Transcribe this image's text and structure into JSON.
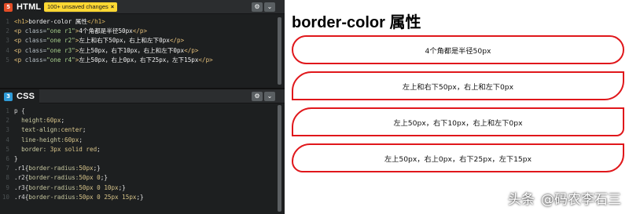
{
  "html_pane": {
    "title": "HTML",
    "icon": "html5-icon",
    "unsaved_badge": "100+ unsaved changes",
    "unsaved_close": "×",
    "settings_icon": "⚙",
    "collapse_icon": "⌄",
    "lines": [
      {
        "n": "1",
        "parts": [
          [
            "tagb",
            "<h1>"
          ],
          [
            "txt",
            "border-color 属性"
          ],
          [
            "tagb",
            "</h1>"
          ]
        ]
      },
      {
        "n": "2",
        "parts": [
          [
            "tag",
            "<p "
          ],
          [
            "attr",
            "class="
          ],
          [
            "str",
            "\"one r1\""
          ],
          [
            "tag",
            ">"
          ],
          [
            "txt",
            "4个角都是半径50px"
          ],
          [
            "tag",
            "</p>"
          ]
        ]
      },
      {
        "n": "3",
        "parts": [
          [
            "tag",
            "<p "
          ],
          [
            "attr",
            "class="
          ],
          [
            "str",
            "\"one r2\""
          ],
          [
            "tag",
            ">"
          ],
          [
            "txt",
            "左上和右下50px，右上和左下0px"
          ],
          [
            "tag",
            "</p>"
          ]
        ]
      },
      {
        "n": "4",
        "parts": [
          [
            "tag",
            "<p "
          ],
          [
            "attr",
            "class="
          ],
          [
            "str",
            "\"one r3\""
          ],
          [
            "tag",
            ">"
          ],
          [
            "txt",
            "左上50px，右下10px，右上和左下0px"
          ],
          [
            "tag",
            "</p>"
          ]
        ]
      },
      {
        "n": "5",
        "parts": [
          [
            "tag",
            "<p "
          ],
          [
            "attr",
            "class="
          ],
          [
            "str",
            "\"one r4\""
          ],
          [
            "tag",
            ">"
          ],
          [
            "txt",
            "左上50px，右上0px，右下25px，左下15px"
          ],
          [
            "tag",
            "</p>"
          ]
        ]
      }
    ]
  },
  "css_pane": {
    "title": "CSS",
    "icon": "css3-icon",
    "settings_icon": "⚙",
    "collapse_icon": "⌄",
    "lines": [
      {
        "n": "1",
        "parts": [
          [
            "sel",
            "p {"
          ]
        ]
      },
      {
        "n": "2",
        "parts": [
          [
            "prop",
            "  height:"
          ],
          [
            "val",
            "60px"
          ],
          [
            "brace",
            ";"
          ]
        ]
      },
      {
        "n": "3",
        "parts": [
          [
            "prop",
            "  text-align:"
          ],
          [
            "val",
            "center"
          ],
          [
            "brace",
            ";"
          ]
        ]
      },
      {
        "n": "4",
        "parts": [
          [
            "prop",
            "  line-height:"
          ],
          [
            "val",
            "60px"
          ],
          [
            "brace",
            ";"
          ]
        ]
      },
      {
        "n": "5",
        "parts": [
          [
            "prop",
            "  border: "
          ],
          [
            "val",
            "3px solid red"
          ],
          [
            "brace",
            ";"
          ]
        ]
      },
      {
        "n": "6",
        "parts": [
          [
            "brace",
            "}"
          ]
        ]
      },
      {
        "n": "7",
        "parts": [
          [
            "sel",
            ".r1"
          ],
          [
            "brace",
            "{"
          ],
          [
            "prop",
            "border-radius:"
          ],
          [
            "val",
            "50px"
          ],
          [
            "brace",
            ";}"
          ]
        ]
      },
      {
        "n": "8",
        "parts": [
          [
            "sel",
            ".r2"
          ],
          [
            "brace",
            "{"
          ],
          [
            "prop",
            "border-radius:"
          ],
          [
            "val",
            "50px 0"
          ],
          [
            "brace",
            ";}"
          ]
        ]
      },
      {
        "n": "9",
        "parts": [
          [
            "sel",
            ".r3"
          ],
          [
            "brace",
            "{"
          ],
          [
            "prop",
            "border-radius:"
          ],
          [
            "val",
            "50px 0 10px"
          ],
          [
            "brace",
            ";}"
          ]
        ]
      },
      {
        "n": "10",
        "parts": [
          [
            "sel",
            ".r4"
          ],
          [
            "brace",
            "{"
          ],
          [
            "prop",
            "border-radius:"
          ],
          [
            "val",
            "50px 0 25px 15px"
          ],
          [
            "brace",
            ";}"
          ]
        ]
      }
    ]
  },
  "result": {
    "heading": "border-color 属性",
    "boxes": [
      "4个角都是半径50px",
      "左上和右下50px，右上和左下0px",
      "左上50px，右下10px，右上和左下0px",
      "左上50px，右上0px，右下25px，左下15px"
    ],
    "border_color": "#e0171b"
  },
  "watermark": {
    "platform": "头条",
    "author": "@码农李石三"
  }
}
